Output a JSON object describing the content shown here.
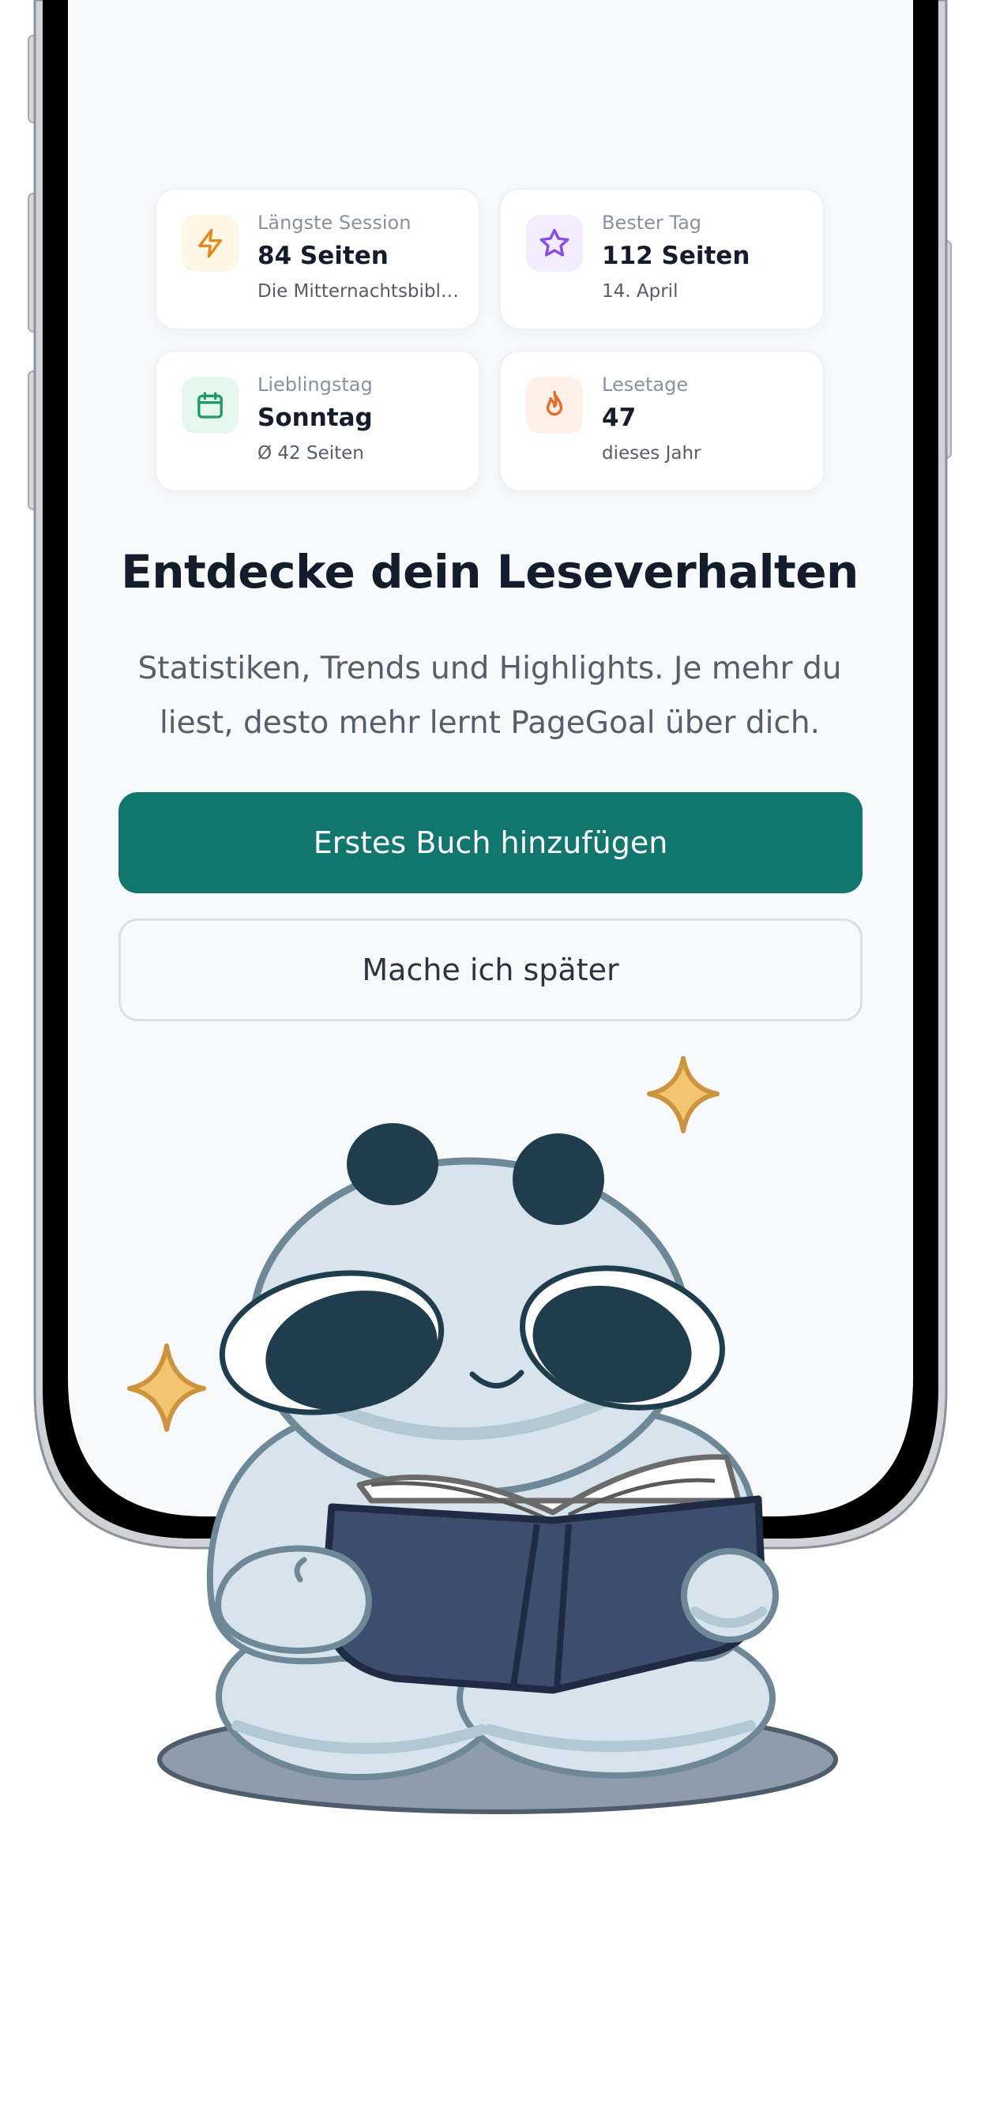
{
  "stats": [
    {
      "label": "Längste Session",
      "value": "84 Seiten",
      "sub": "Die Mitternachtsbibli...",
      "icon": "lightning-icon",
      "color": "#e28a1b",
      "bg": "#fff6e6"
    },
    {
      "label": "Bester Tag",
      "value": "112 Seiten",
      "sub": "14. April",
      "icon": "star-icon",
      "color": "#8a4de8",
      "bg": "#f3edff"
    },
    {
      "label": "Lieblingstag",
      "value": "Sonntag",
      "sub": "Ø 42 Seiten",
      "icon": "calendar-icon",
      "color": "#1f9a6a",
      "bg": "#e6f7ef"
    },
    {
      "label": "Lesetage",
      "value": "47",
      "sub": "dieses Jahr",
      "icon": "flame-icon",
      "color": "#ea6a2a",
      "bg": "#fff0e8"
    }
  ],
  "headline": "Entdecke dein Leseverhalten",
  "description": "Statistiken, Trends und Highlights. Je mehr du liest, desto mehr lernt PageGoal über dich.",
  "primary_button": "Erstes Buch hinzufügen",
  "secondary_button": "Mache ich später",
  "colors": {
    "accent": "#11766d",
    "screen_bg": "#f8f9fb",
    "heading": "#141b2b"
  }
}
